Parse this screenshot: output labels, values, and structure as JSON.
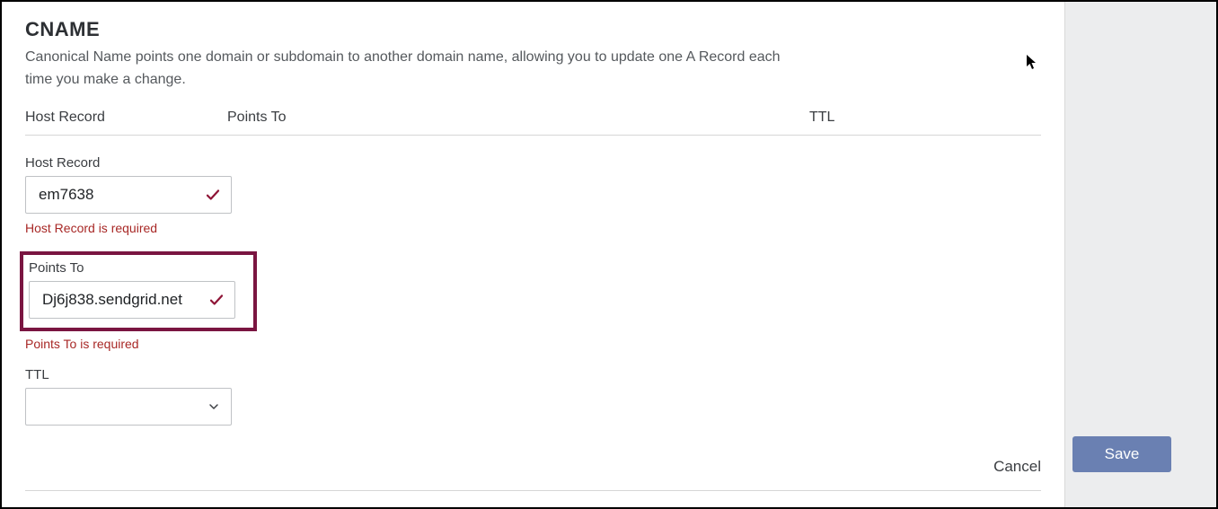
{
  "section": {
    "title": "CNAME",
    "description": "Canonical Name points one domain or subdomain to another domain name, allowing you to update one A Record each time you make a change."
  },
  "columns": {
    "host": "Host Record",
    "points_to": "Points To",
    "ttl": "TTL"
  },
  "fields": {
    "host": {
      "label": "Host Record",
      "value": "em7638",
      "error": "Host Record is required"
    },
    "points_to": {
      "label": "Points To",
      "value": "Dj6j838.sendgrid.net",
      "error": "Points To is required"
    },
    "ttl": {
      "label": "TTL",
      "value": ""
    }
  },
  "actions": {
    "cancel": "Cancel",
    "save": "Save"
  }
}
